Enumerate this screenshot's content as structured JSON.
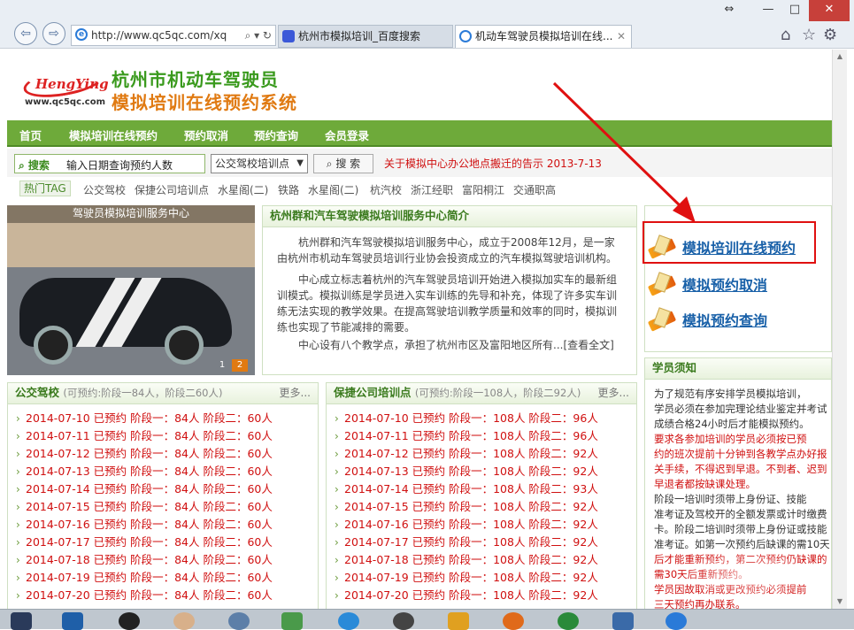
{
  "browser": {
    "url": "http://www.qc5qc.com/xq",
    "tabs": [
      {
        "label": "杭州市模拟培训_百度搜索"
      },
      {
        "label": "机动车驾驶员模拟培训在线..."
      }
    ],
    "window_controls": {
      "restore": "⇔",
      "minimize": "—",
      "maximize": "□",
      "close": "✕"
    }
  },
  "header": {
    "logo_brand": "HengYing",
    "logo_url": "www.qc5qc.com",
    "title_line1": "杭州市机动车驾驶员",
    "title_line2": "模拟培训在线预约系统"
  },
  "nav": {
    "items": [
      "首页",
      "模拟培训在线预约",
      "预约取消",
      "预约查询",
      "会员登录"
    ]
  },
  "search": {
    "label": "搜索",
    "value": "输入日期查询预约人数",
    "select_value": "公交驾校培训点",
    "button": "搜 索",
    "notice": "关于模拟中心办公地点搬迁的告示 2013-7-13"
  },
  "hot_tags": {
    "label": "热门TAG",
    "items": [
      "公交驾校",
      "保捷公司培训点",
      "水星阁(二)",
      "铁路",
      "水星阁(二)",
      "杭汽校",
      "浙江经职",
      "富阳桐江",
      "交通职高"
    ]
  },
  "banner": {
    "caption": "驾驶员模拟培训服务中心",
    "pager": [
      "1",
      "2"
    ]
  },
  "intro": {
    "title": "杭州群和汽车驾驶模拟培训服务中心简介",
    "paragraphs": [
      "杭州群和汽车驾驶模拟培训服务中心，成立于2008年12月，是一家由杭州市机动车驾驶员培训行业协会投资成立的汽车模拟驾驶培训机构。",
      "中心成立标志着杭州的汽车驾驶员培训开始进入模拟加实车的最新组训模式。模拟训练是学员进入实车训练的先导和补充，体现了许多实车训练无法实现的教学效果。在提高驾驶培训教学质量和效率的同时，模拟训练也实现了节能减排的需要。",
      "中心设有八个教学点，承担了杭州市区及富阳地区所有...[查看全文]"
    ]
  },
  "quick_links": [
    "模拟培训在线预约",
    "模拟预约取消",
    "模拟预约查询"
  ],
  "notes": {
    "title": "学员须知",
    "lines": [
      {
        "text": "为了规范有序安排学员模拟培训，",
        "red": false
      },
      {
        "text": "学员必须在参加完理论结业鉴定并考试",
        "red": false
      },
      {
        "text": "成绩合格24小时后才能模拟预约。",
        "red": false
      },
      {
        "text": "要求各参加培训的学员必须按已预",
        "red": true
      },
      {
        "text": "约的班次提前十分钟到各教学点办好报",
        "red": true
      },
      {
        "text": "关手续，不得迟到早退。不到者、迟到",
        "red": true
      },
      {
        "text": "早退者都按缺课处理。",
        "red": true
      },
      {
        "text": "阶段一培训时须带上身份证、技能",
        "red": false
      },
      {
        "text": "准考证及驾校开的全额发票或计时缴费",
        "red": false
      },
      {
        "text": "卡。阶段二培训时须带上身份证或技能",
        "red": false
      },
      {
        "text": "准考证。如第一次预约后缺课的需10天",
        "red": false
      },
      {
        "text": "后才能重新预约，第二次预约仍缺课的",
        "red": true
      },
      {
        "text": "需30天后重新预约。",
        "red": true
      },
      {
        "text": "学员因故取消或更改预约必须提前",
        "red": true
      },
      {
        "text": "三天预约再办联系。",
        "red": true
      }
    ]
  },
  "list_a": {
    "title": "公交驾校",
    "subtitle": "(可预约:阶段一84人，阶段二60人)",
    "more": "更多...",
    "rows": [
      "2014-07-10 已预约 阶段一：84人  阶段二：60人",
      "2014-07-11 已预约 阶段一：84人  阶段二：60人",
      "2014-07-12 已预约 阶段一：84人  阶段二：60人",
      "2014-07-13 已预约 阶段一：84人  阶段二：60人",
      "2014-07-14 已预约 阶段一：84人  阶段二：60人",
      "2014-07-15 已预约 阶段一：84人  阶段二：60人",
      "2014-07-16 已预约 阶段一：84人  阶段二：60人",
      "2014-07-17 已预约 阶段一：84人  阶段二：60人",
      "2014-07-18 已预约 阶段一：84人  阶段二：60人",
      "2014-07-19 已预约 阶段一：84人  阶段二：60人",
      "2014-07-20 已预约 阶段一：84人  阶段二：60人"
    ]
  },
  "list_b": {
    "title": "保捷公司培训点",
    "subtitle": "(可预约:阶段一108人，阶段二92人)",
    "more": "更多...",
    "rows": [
      "2014-07-10 已预约 阶段一：108人  阶段二：96人",
      "2014-07-11 已预约 阶段一：108人  阶段二：96人",
      "2014-07-12 已预约 阶段一：108人  阶段二：92人",
      "2014-07-13 已预约 阶段一：108人  阶段二：92人",
      "2014-07-14 已预约 阶段一：108人  阶段二：93人",
      "2014-07-15 已预约 阶段一：108人  阶段二：92人",
      "2014-07-16 已预约 阶段一：108人  阶段二：92人",
      "2014-07-17 已预约 阶段一：108人  阶段二：92人",
      "2014-07-18 已预约 阶段一：108人  阶段二：92人",
      "2014-07-19 已预约 阶段一：108人  阶段二：92人",
      "2014-07-20 已预约 阶段一：108人  阶段二：92人"
    ]
  },
  "colors": {
    "nav_green": "#6eaa3a",
    "title_green": "#3a9a1d",
    "title_orange": "#e07a12",
    "alert_red": "#d01010",
    "link_blue": "#1860a8"
  }
}
